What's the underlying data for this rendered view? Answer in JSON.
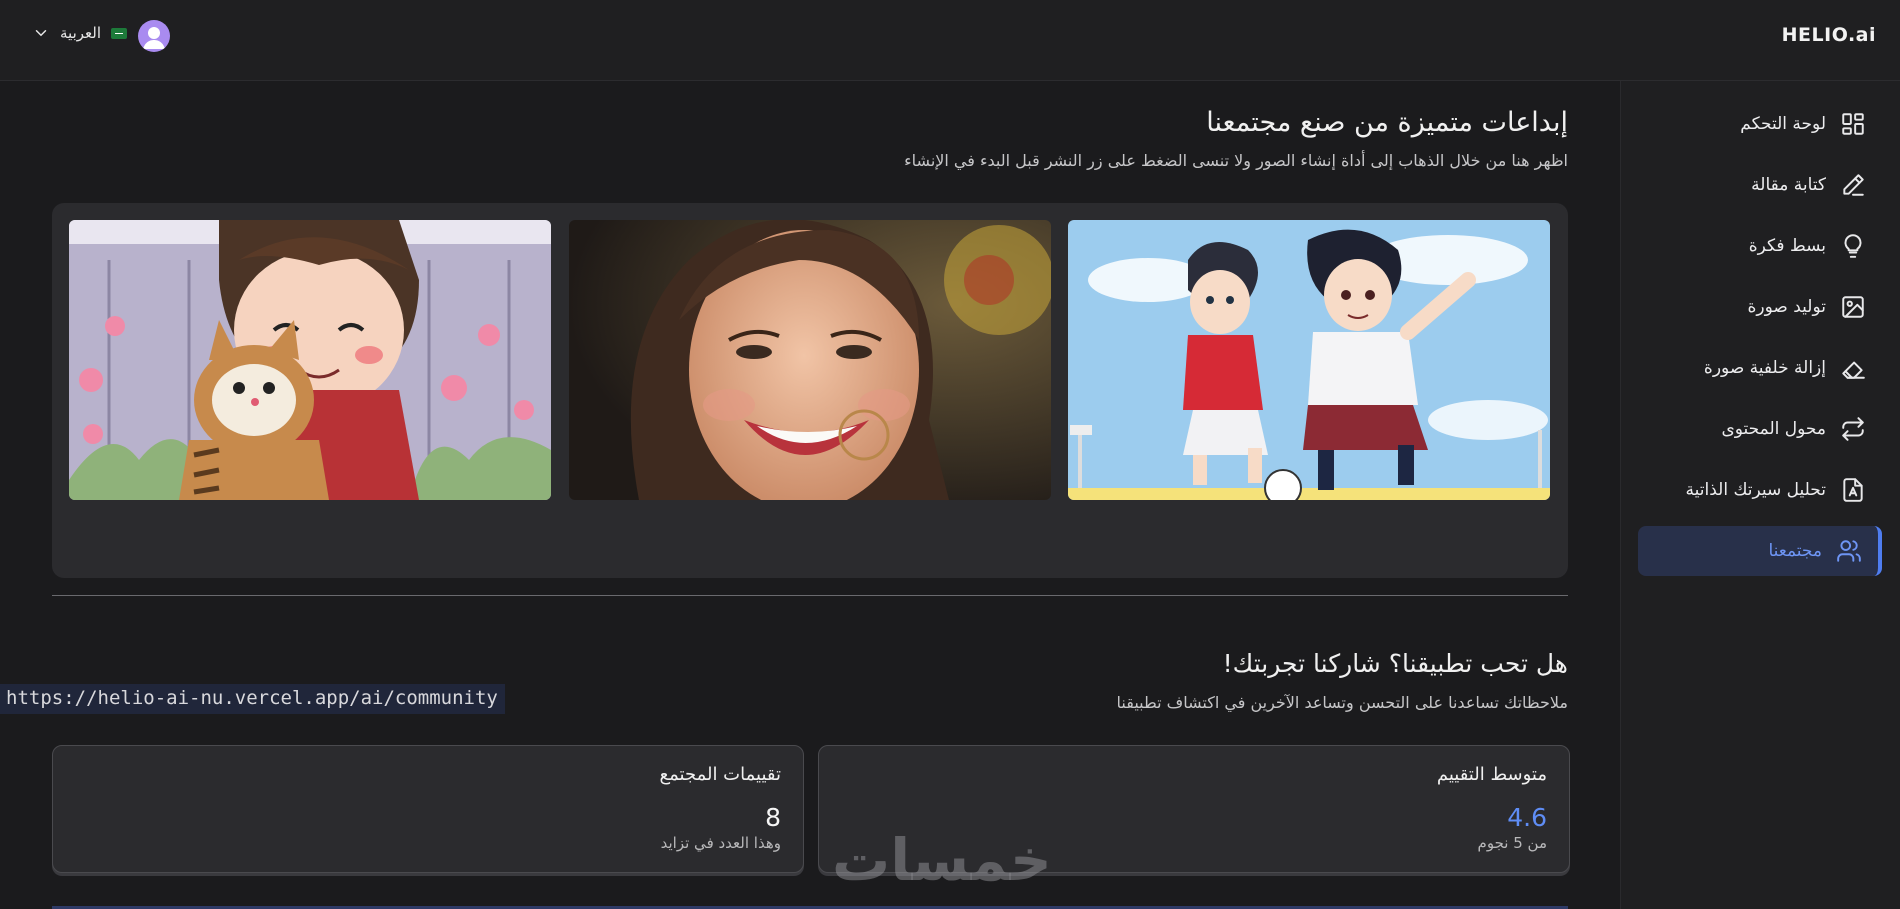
{
  "header": {
    "brand": "HELIO.ai",
    "language": "العربية",
    "flag_icon": "saudi-flag-icon",
    "avatar_icon": "user-avatar-icon"
  },
  "sidebar": {
    "items": [
      {
        "label": "لوحة التحكم",
        "icon": "dashboard-icon"
      },
      {
        "label": "كتابة مقالة",
        "icon": "pen-icon"
      },
      {
        "label": "بسط فكرة",
        "icon": "lightbulb-icon"
      },
      {
        "label": "توليد صورة",
        "icon": "image-icon"
      },
      {
        "label": "إزالة خلفية صورة",
        "icon": "eraser-icon"
      },
      {
        "label": "محول المحتوى",
        "icon": "repeat-icon"
      },
      {
        "label": "تحليل سيرتك الذاتية",
        "icon": "resume-icon"
      },
      {
        "label": "مجتمعنا",
        "icon": "users-icon",
        "active": true
      }
    ],
    "accent": "#4f7df0"
  },
  "main": {
    "title": "إبداعات متميزة من صنع مجتمعنا",
    "subtitle": "اظهر هنا من خلال الذهاب إلى أداة إنشاء الصور ولا تنسى الضغط على زر النشر قبل البدء في الإنشاء",
    "gallery": [
      "boy-hugging-cat-image",
      "smiling-woman-image",
      "soccer-boys-image"
    ],
    "feedback_title": "هل تحب تطبيقنا؟ شاركنا تجربتك!",
    "feedback_subtitle": "ملاحظاتك تساعدنا على التحسن وتساعد الآخرين في اكتشاف تطبيقنا",
    "stats": {
      "average": {
        "title": "متوسط التقييم",
        "value": "4.6",
        "note": "من 5 نجوم"
      },
      "count": {
        "title": "تقييمات المجتمع",
        "value": "8",
        "note": "وهذا العدد في تزايد"
      }
    }
  },
  "status_url": "https://helio-ai-nu.vercel.app/ai/community",
  "watermark": "خمسات"
}
